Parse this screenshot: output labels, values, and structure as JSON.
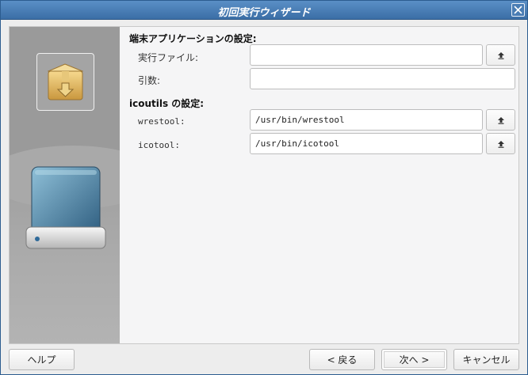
{
  "window": {
    "title": "初回実行ウィザード"
  },
  "terminal_section": {
    "title": "端末アプリケーションの設定:",
    "executable_label": "実行ファイル:",
    "executable_value": "",
    "arguments_label": "引数:",
    "arguments_value": ""
  },
  "icoutils_section": {
    "title": "icoutils の設定:",
    "wrestool_label": "wrestool:",
    "wrestool_value": "/usr/bin/wrestool",
    "icotool_label": "icotool:",
    "icotool_value": "/usr/bin/icotool"
  },
  "buttons": {
    "help": "ヘルプ",
    "back": "< 戻る",
    "next": "次へ >",
    "cancel": "キャンセル"
  },
  "icons": {
    "close": "close-icon",
    "package": "package-icon",
    "drive": "drive-icon",
    "browse": "upload-arrow-icon"
  },
  "colors": {
    "titlebar": "#3b6ea6",
    "panel": "#9c9c9c"
  }
}
